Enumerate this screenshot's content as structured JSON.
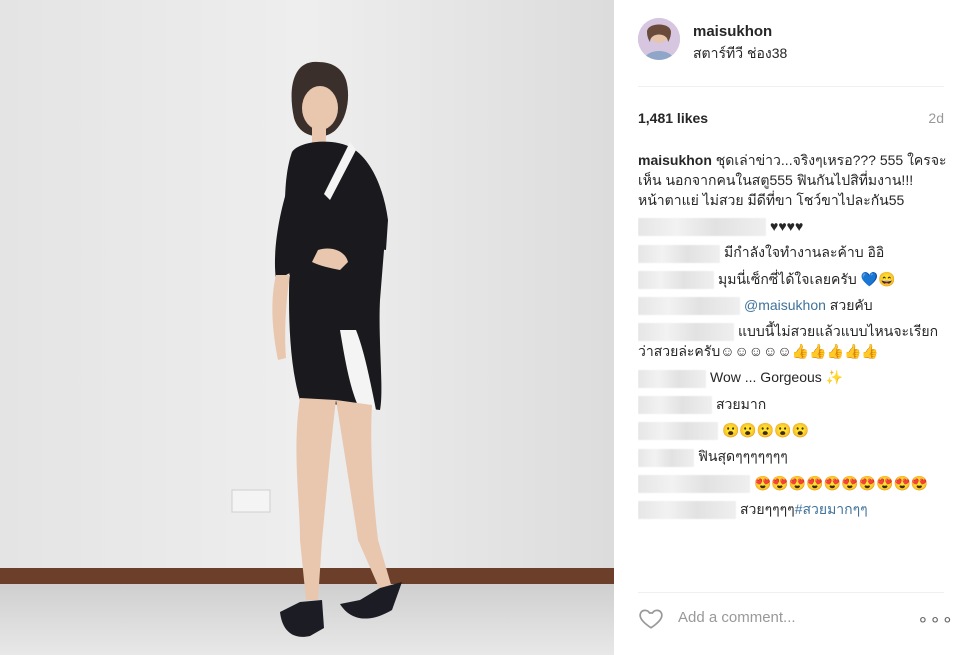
{
  "post": {
    "username": "maisukhon",
    "location": "สตาร์ทีวี ช่อง38",
    "likes": "1,481 likes",
    "time_ago": "2d",
    "caption_user": "maisukhon",
    "caption_text": "ชุดเล่าข่าว...จริงๆเหรอ??? 555 ใครจะเห็น นอกจากคนในสตู555 ฟินกันไปสิที่มงาน!!! หน้าตาแย่ ไม่สวย มีดีที่ขา โชว์ขาไปละกัน55"
  },
  "comments": [
    {
      "text": "♥♥♥♥"
    },
    {
      "text": "มีกำลังใจทำงานละค้าบ อิอิ"
    },
    {
      "text": "มุมนี่เซ็กซี่ได้ใจเลยครับ 💙😄"
    },
    {
      "mention": "@maisukhon",
      "text": " สวยคับ"
    },
    {
      "text": "แบบนี้ไม่สวยแล้วแบบไหนจะเรียกว่าสวยล่ะครับ☺☺☺☺☺👍👍👍👍👍"
    },
    {
      "text": "Wow ... Gorgeous ✨"
    },
    {
      "text": "สวยมาก"
    },
    {
      "text": "😮😮😮😮😮"
    },
    {
      "text": "ฟินสุดๆๆๆๆๆๆๆ"
    },
    {
      "text": "😍😍😍😍😍😍😍😍😍😍"
    },
    {
      "text": "สวยๆๆๆๆ",
      "hashtag": "#สวยมากๆๆ"
    }
  ],
  "add_comment_placeholder": "Add a comment...",
  "more_label": "∘∘∘",
  "icons": {
    "like": "heart-outline-icon",
    "more": "more-options-icon"
  },
  "colors": {
    "link": "#3f729b",
    "muted": "#999999",
    "divider": "#efefef"
  }
}
